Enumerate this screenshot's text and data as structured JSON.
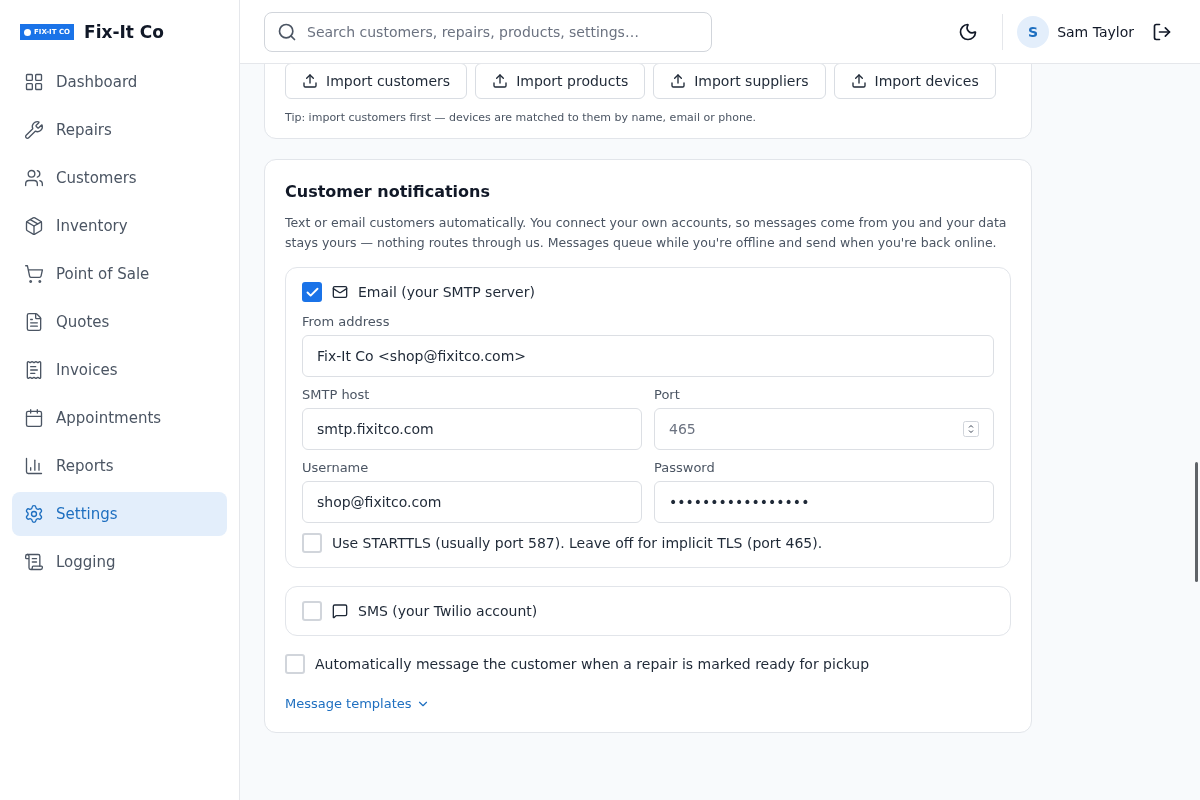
{
  "brand": {
    "logo_text": "FIX-IT CO",
    "name": "Fix-It Co"
  },
  "sidebar": {
    "items": [
      {
        "label": "Dashboard",
        "selected": false
      },
      {
        "label": "Repairs",
        "selected": false
      },
      {
        "label": "Customers",
        "selected": false
      },
      {
        "label": "Inventory",
        "selected": false
      },
      {
        "label": "Point of Sale",
        "selected": false
      },
      {
        "label": "Quotes",
        "selected": false
      },
      {
        "label": "Invoices",
        "selected": false
      },
      {
        "label": "Appointments",
        "selected": false
      },
      {
        "label": "Reports",
        "selected": false
      },
      {
        "label": "Settings",
        "selected": true
      },
      {
        "label": "Logging",
        "selected": false
      }
    ]
  },
  "header": {
    "search": {
      "placeholder": "Search customers, repairs, products, settings…"
    },
    "user": {
      "initial": "S",
      "name": "Sam Taylor"
    }
  },
  "import_card": {
    "buttons": [
      "Import customers",
      "Import products",
      "Import suppliers",
      "Import devices"
    ],
    "tip": "Tip: import customers first — devices are matched to them by name, email or phone."
  },
  "notifications": {
    "title": "Customer notifications",
    "description": "Text or email customers automatically. You connect your own accounts, so messages come from you and your data stays yours — nothing routes through us. Messages queue while you're offline and send when you're back online.",
    "channels": [
      {
        "kind": "email",
        "label": "Email (your SMTP server)",
        "checked": true,
        "fields": [
          {
            "kind": "text",
            "label": "From address",
            "value": "Fix-It Co <shop@fixitco.com>"
          },
          {
            "kind": "text",
            "label": "SMTP host",
            "value": "smtp.fixitco.com"
          },
          {
            "kind": "number",
            "label": "Port",
            "placeholder": "465"
          },
          {
            "kind": "text",
            "label": "Username",
            "value": "shop@fixitco.com"
          },
          {
            "kind": "text",
            "label": "Password",
            "value": "•••••••••••••••••"
          }
        ],
        "starttls": {
          "label": "Use STARTTLS (usually port 587). Leave off for implicit TLS (port 465).",
          "checked": false
        }
      },
      {
        "kind": "sms",
        "label": "SMS (your Twilio account)",
        "checked": false
      }
    ],
    "auto_message": {
      "label": "Automatically message the customer when a repair is marked ready for pickup",
      "checked": false
    },
    "templates_link": "Message templates"
  }
}
